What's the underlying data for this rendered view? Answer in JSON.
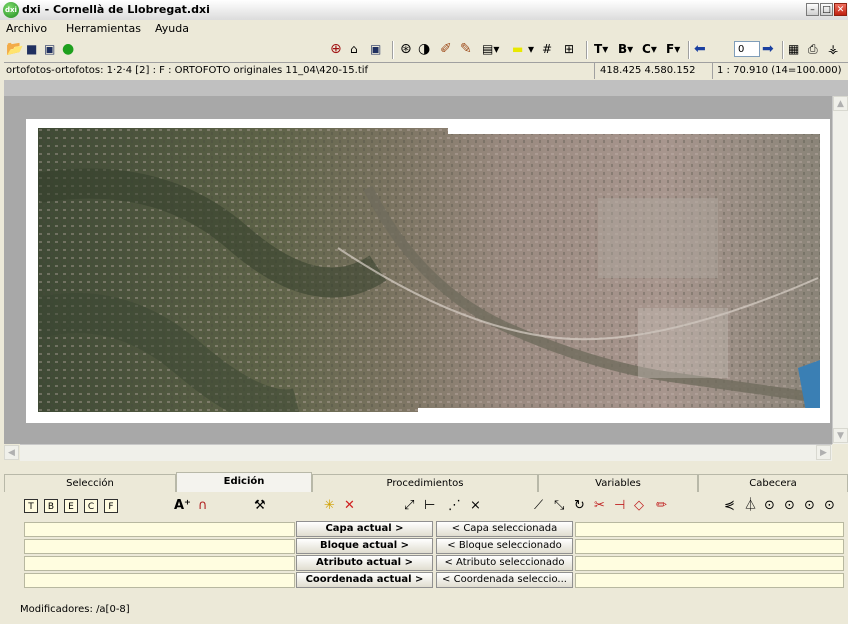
{
  "window": {
    "title": "dxi - Cornellà de Llobregat.dxi",
    "app_icon_text": "dxi",
    "minimize_glyph": "–",
    "maximize_glyph": "□",
    "close_glyph": "✕"
  },
  "menu": {
    "items": [
      "Archivo",
      "Herramientas",
      "Ayuda"
    ]
  },
  "toolbar": {
    "text_tools": [
      "T",
      "B",
      "C",
      "F"
    ],
    "zoom_value": "0"
  },
  "status": {
    "path": "ortofotos-ortofotos: 1·2·4 [2] : F : ORTOFOTO originales 11_04\\420-15.tif",
    "coords": "418.425  4.580.152",
    "scale": "1 : 70.910 (14=100.000)"
  },
  "tabs": [
    "Selección",
    "Edición",
    "Procedimientos",
    "Variables",
    "Cabecera"
  ],
  "active_tab": "Edición",
  "panel": {
    "rows": [
      {
        "left_button": "Capa actual >",
        "right_button": "< Capa seleccionada"
      },
      {
        "left_button": "Bloque actual >",
        "right_button": "< Bloque seleccionado"
      },
      {
        "left_button": "Atributo actual >",
        "right_button": "< Atributo seleccionado"
      },
      {
        "left_button": "Coordenada actual >",
        "right_button": "< Coordenada seleccio..."
      }
    ],
    "modifiers": "Modificadores: /a[0-8]"
  },
  "colors": {
    "window_bg": "#ece9d8",
    "canvas_bg": "#a8a8a8",
    "field_bg": "#fffde0",
    "title_green": "#1d8a1d"
  }
}
